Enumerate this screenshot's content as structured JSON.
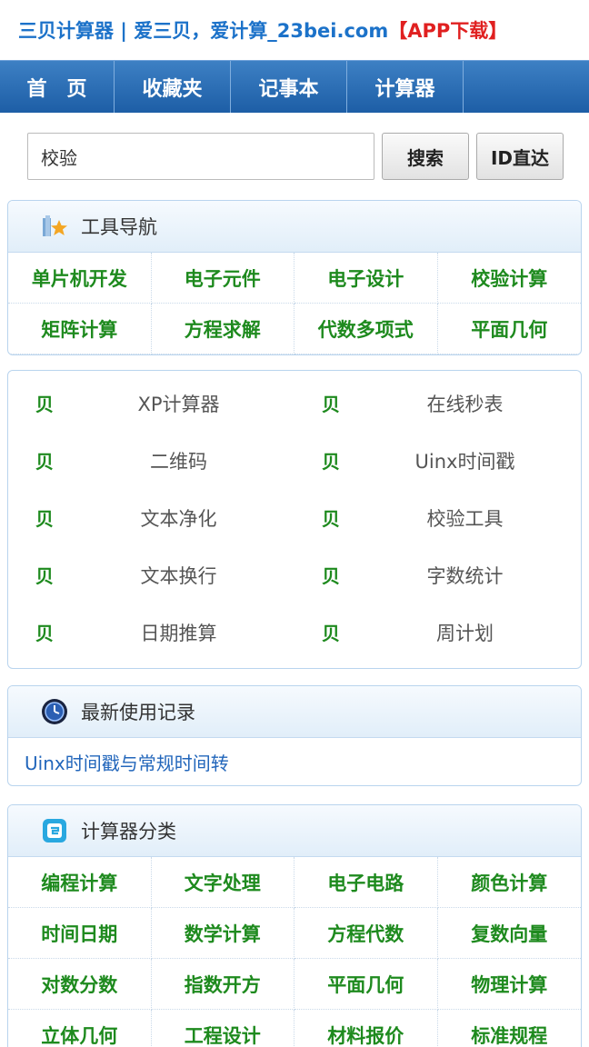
{
  "banner": {
    "site": "三贝计算器 | 爱三贝，爱计算_23bei.com",
    "app": "【APP下载】"
  },
  "nav": [
    {
      "label": "首页"
    },
    {
      "label": "收藏夹"
    },
    {
      "label": "记事本"
    },
    {
      "label": "计算器"
    }
  ],
  "search": {
    "value": "校验",
    "search_label": "搜索",
    "id_label": "ID直达"
  },
  "tool_nav": {
    "title": "工具导航",
    "items": [
      "单片机开发",
      "电子元件",
      "电子设计",
      "校验计算",
      "矩阵计算",
      "方程求解",
      "代数多项式",
      "平面几何"
    ]
  },
  "tools": {
    "marker": "贝",
    "items": [
      "XP计算器",
      "在线秒表",
      "二维码",
      "Uinx时间戳",
      "文本净化",
      "校验工具",
      "文本换行",
      "字数统计",
      "日期推算",
      "周计划"
    ]
  },
  "recent": {
    "title": "最新使用记录",
    "items": [
      "Uinx时间戳与常规时间转"
    ]
  },
  "categories": {
    "title": "计算器分类",
    "items": [
      "编程计算",
      "文字处理",
      "电子电路",
      "颜色计算",
      "时间日期",
      "数学计算",
      "方程代数",
      "复数向量",
      "对数分数",
      "指数开方",
      "平面几何",
      "物理计算",
      "立体几何",
      "工程设计",
      "材料报价",
      "标准规程"
    ]
  },
  "colors": {
    "brand_blue": "#1c72c9",
    "app_red": "#e02020",
    "nav_blue": "#2a6cb3",
    "link_green": "#1e8a1e",
    "link_blue": "#2266bb"
  }
}
